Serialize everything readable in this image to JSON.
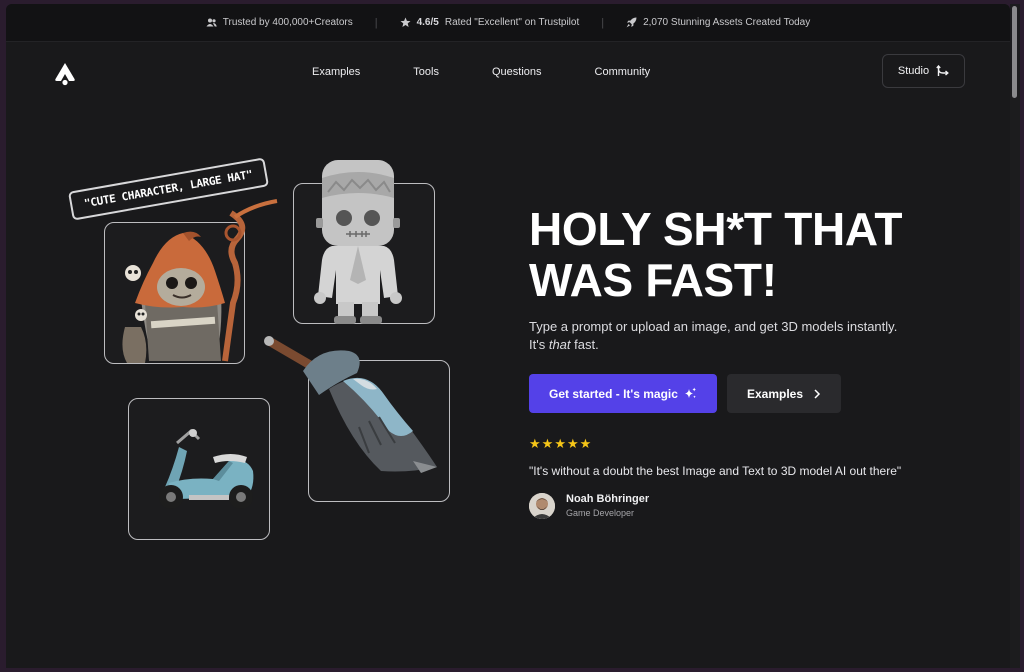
{
  "banner": {
    "items": [
      {
        "icon": "users-icon",
        "strong": "",
        "text": "Trusted by 400,000+Creators"
      },
      {
        "icon": "star-icon",
        "strong": "4.6/5",
        "text": "Rated \"Excellent\" on Trustpilot"
      },
      {
        "icon": "rocket-icon",
        "strong": "",
        "text": "2,070 Stunning Assets Created Today"
      }
    ],
    "separator": "|"
  },
  "nav": {
    "logo_icon": "logo-icon",
    "links": [
      "Examples",
      "Tools",
      "Questions",
      "Community"
    ],
    "studio_label": "Studio"
  },
  "hero": {
    "headline_line1": "HOLY SH*T THAT",
    "headline_line2": "WAS FAST!",
    "subtext_line1": "Type a prompt or upload an image, and get 3D models instantly.",
    "subtext_line2_pre": "It's ",
    "subtext_line2_em": "that",
    "subtext_line2_post": " fast.",
    "cta_primary": "Get started - It's magic",
    "cta_primary_icon": "sparkles-icon",
    "cta_secondary": "Examples",
    "cta_secondary_icon": "chevron-right-icon"
  },
  "testimonial": {
    "rating": 5,
    "star": "★",
    "quote": "\"It's without a doubt the best Image and Text to 3D model AI out there\"",
    "author_name": "Noah Böhringer",
    "author_role": "Game Developer"
  },
  "gallery": {
    "prompt_tag": "\"CUTE CHARACTER, LARGE HAT\"",
    "items": [
      "wizard-character-model",
      "frankenstein-figure-model",
      "scooter-model",
      "fantasy-sword-model"
    ]
  },
  "colors": {
    "background": "#19191b",
    "primary": "#5441e8",
    "secondary": "#2a2a2d",
    "star": "#f5c518"
  }
}
